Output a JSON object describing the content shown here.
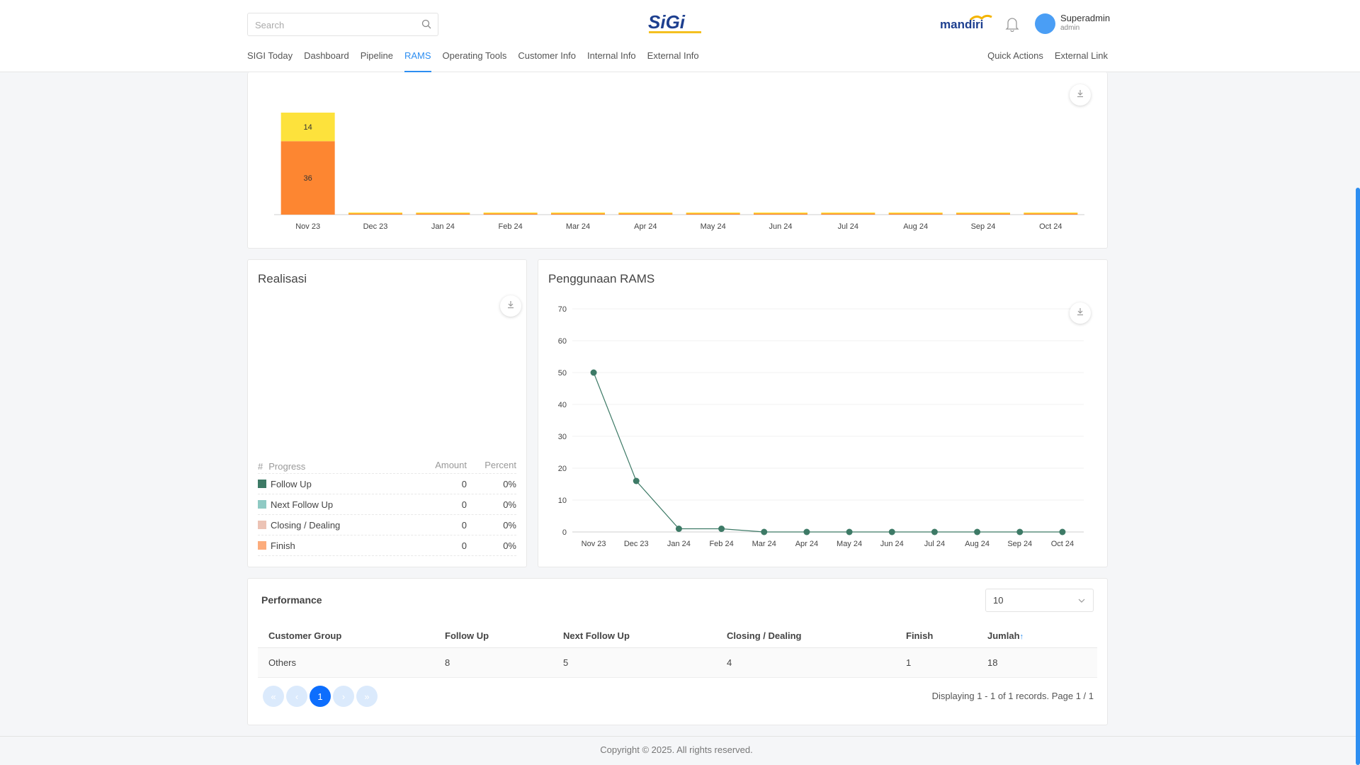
{
  "header": {
    "search_placeholder": "Search",
    "logo_text": "SiGi",
    "mandiri_text": "mandiri",
    "user_name": "Superadmin",
    "user_role": "admin",
    "nav_tabs": [
      "SIGI Today",
      "Dashboard",
      "Pipeline",
      "RAMS",
      "Operating Tools",
      "Customer Info",
      "Internal Info",
      "External Info"
    ],
    "active_tab": "RAMS",
    "nav_right": [
      "Quick Actions",
      "External Link"
    ]
  },
  "colors": {
    "accent": "#2d8ef1",
    "orange": "#fd8631",
    "yellow": "#fde23c",
    "green": "#3d7a66",
    "teal": "#8fcac4",
    "pink": "#ecc3b5",
    "light_orange": "#fcac7c"
  },
  "chart_data": [
    {
      "type": "bar",
      "stacked": true,
      "categories": [
        "Nov 23",
        "Dec 23",
        "Jan 24",
        "Feb 24",
        "Mar 24",
        "Apr 24",
        "May 24",
        "Jun 24",
        "Jul 24",
        "Aug 24",
        "Sep 24",
        "Oct 24"
      ],
      "series": [
        {
          "values": [
            36,
            0,
            0,
            0,
            0,
            0,
            0,
            0,
            0,
            0,
            0,
            0
          ],
          "color": "#fd8631"
        },
        {
          "values": [
            14,
            0,
            0,
            0,
            0,
            0,
            0,
            0,
            0,
            0,
            0,
            0
          ],
          "color": "#fde23c"
        }
      ],
      "data_labels": [
        "36",
        "14"
      ]
    },
    {
      "type": "line",
      "title": "Penggunaan RAMS",
      "categories": [
        "Nov 23",
        "Dec 23",
        "Jan 24",
        "Feb 24",
        "Mar 24",
        "Apr 24",
        "May 24",
        "Jun 24",
        "Jul 24",
        "Aug 24",
        "Sep 24",
        "Oct 24"
      ],
      "values": [
        50,
        16,
        1,
        1,
        0,
        0,
        0,
        0,
        0,
        0,
        0,
        0
      ],
      "ylim": [
        0,
        70
      ],
      "yticks": [
        0,
        10,
        20,
        30,
        40,
        50,
        60,
        70
      ],
      "grid": true,
      "color": "#3d7a66"
    }
  ],
  "realisasi": {
    "title": "Realisasi",
    "headers": {
      "hash": "#",
      "progress": "Progress",
      "amount": "Amount",
      "percent": "Percent"
    },
    "rows": [
      {
        "label": "Follow Up",
        "amount": "0",
        "percent": "0%",
        "color": "#3d7a66"
      },
      {
        "label": "Next Follow Up",
        "amount": "0",
        "percent": "0%",
        "color": "#8fcac4"
      },
      {
        "label": "Closing / Dealing",
        "amount": "0",
        "percent": "0%",
        "color": "#ecc3b5"
      },
      {
        "label": "Finish",
        "amount": "0",
        "percent": "0%",
        "color": "#fcac7c"
      }
    ]
  },
  "performance": {
    "title": "Performance",
    "page_size": "10",
    "columns": [
      "Customer Group",
      "Follow Up",
      "Next Follow Up",
      "Closing / Dealing",
      "Finish",
      "Jumlah"
    ],
    "rows": [
      [
        "Others",
        "8",
        "5",
        "4",
        "1",
        "18"
      ]
    ],
    "current_page": "1",
    "displaying": "Displaying 1 - 1 of 1 records. Page 1 / 1"
  },
  "footer": {
    "copyright": "Copyright © 2025. All rights reserved."
  }
}
